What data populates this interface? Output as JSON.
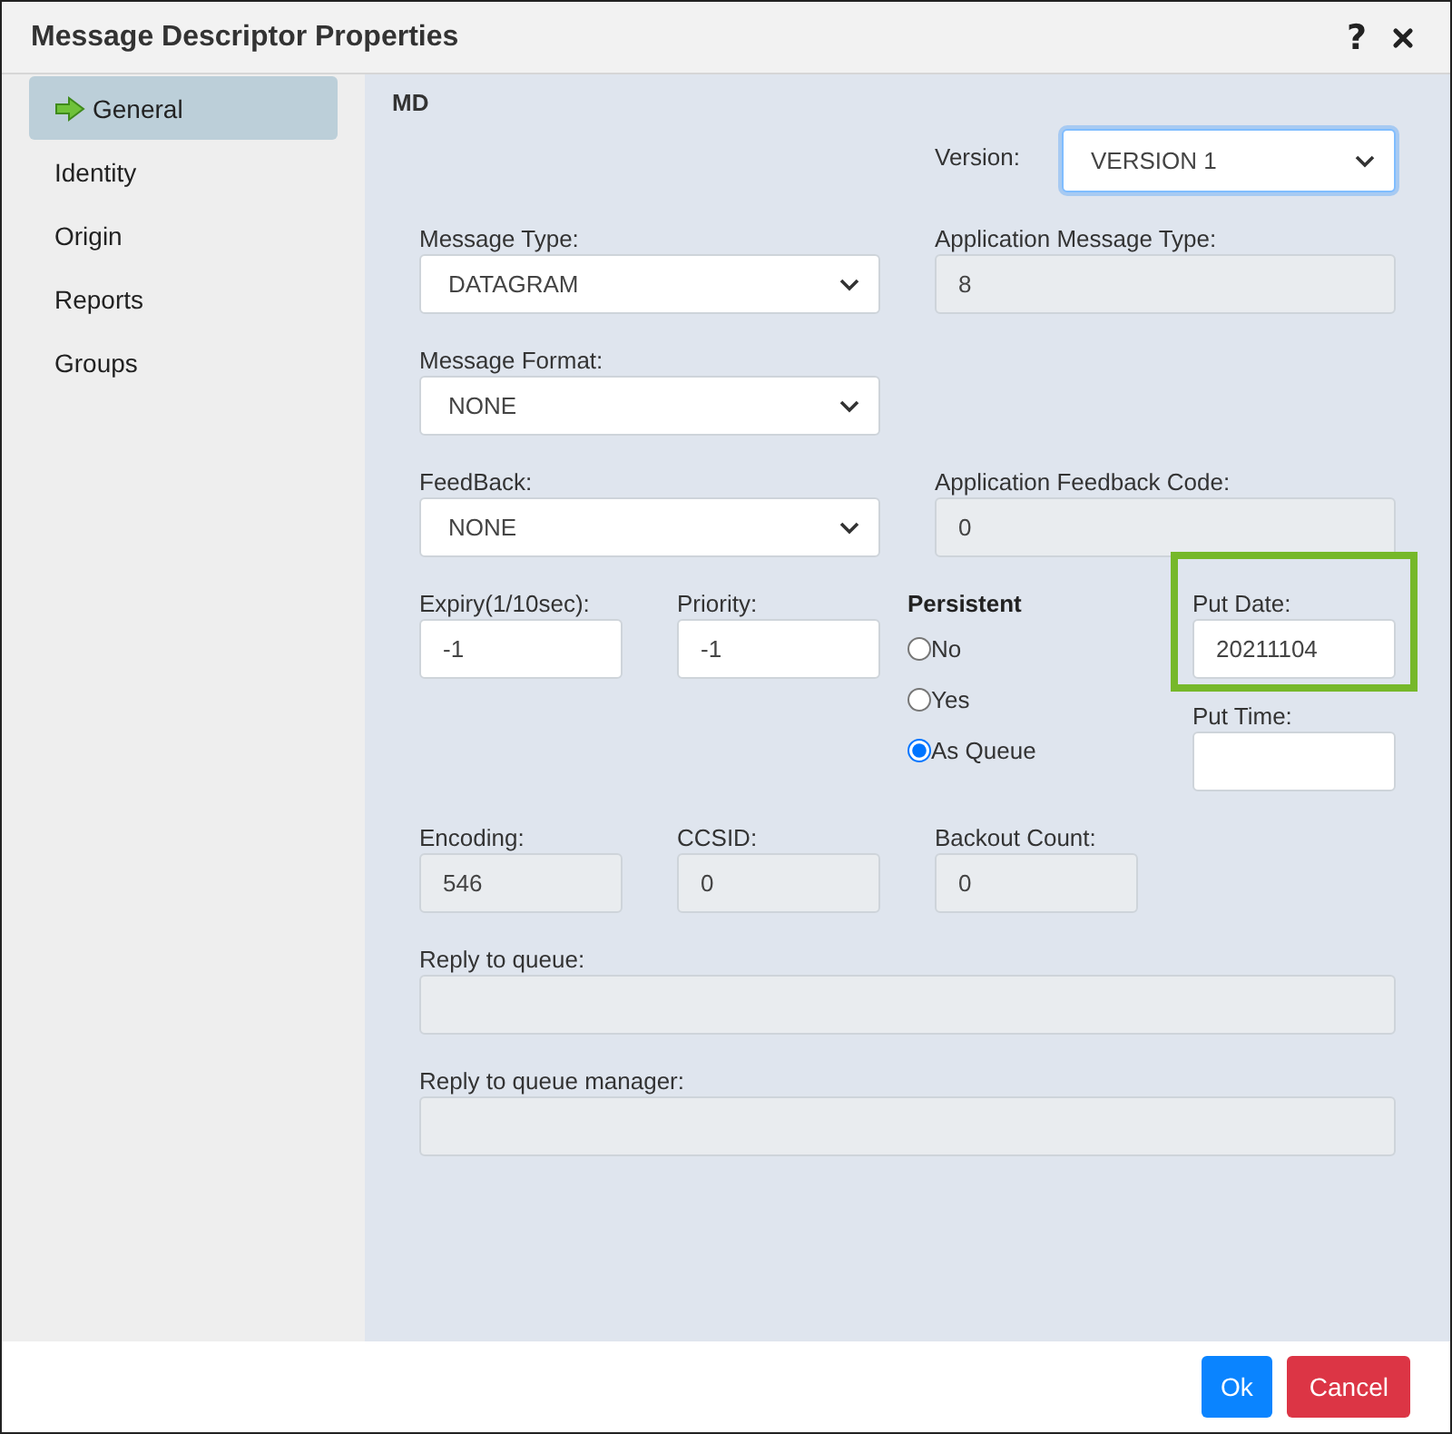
{
  "window": {
    "title": "Message Descriptor Properties",
    "help": "?"
  },
  "sidebar": {
    "items": [
      {
        "label": "General",
        "selected": true
      },
      {
        "label": "Identity",
        "selected": false
      },
      {
        "label": "Origin",
        "selected": false
      },
      {
        "label": "Reports",
        "selected": false
      },
      {
        "label": "Groups",
        "selected": false
      }
    ]
  },
  "section": "MD",
  "version": {
    "label": "Version:",
    "value": "VERSION 1",
    "focused": true
  },
  "message_type": {
    "label": "Message Type:",
    "value": "DATAGRAM"
  },
  "application_message_type": {
    "label": "Application Message Type:",
    "value": "8",
    "disabled": true
  },
  "message_format": {
    "label": "Message Format:",
    "value": "NONE"
  },
  "feedback": {
    "label": "FeedBack:",
    "value": "NONE"
  },
  "application_feedback_code": {
    "label": "Application Feedback Code:",
    "value": "0",
    "disabled": true
  },
  "expiry": {
    "label": "Expiry(1/10sec):",
    "value": "-1",
    "disabled": false
  },
  "priority": {
    "label": "Priority:",
    "value": "-1",
    "disabled": false
  },
  "persistent": {
    "label": "Persistent",
    "options": [
      {
        "label": "No",
        "selected": false
      },
      {
        "label": "Yes",
        "selected": false
      },
      {
        "label": "As Queue",
        "selected": true
      }
    ]
  },
  "put_date": {
    "label": "Put Date:",
    "value": "20211104",
    "highlighted": true
  },
  "put_time": {
    "label": "Put Time:",
    "disabled": false
  },
  "encoding": {
    "label": "Encoding:",
    "value": "546",
    "disabled": true
  },
  "ccsid": {
    "label": "CCSID:",
    "value": "0",
    "disabled": true
  },
  "backout_count": {
    "label": "Backout Count:",
    "value": "0",
    "disabled": true
  },
  "reply_to_queue": {
    "label": "Reply to queue:",
    "disabled": true
  },
  "reply_to_queue_manager": {
    "label": "Reply to queue manager:",
    "disabled": true
  },
  "buttons": [
    {
      "label": "Ok",
      "kind": "primary"
    },
    {
      "label": "Cancel",
      "kind": "danger"
    }
  ]
}
